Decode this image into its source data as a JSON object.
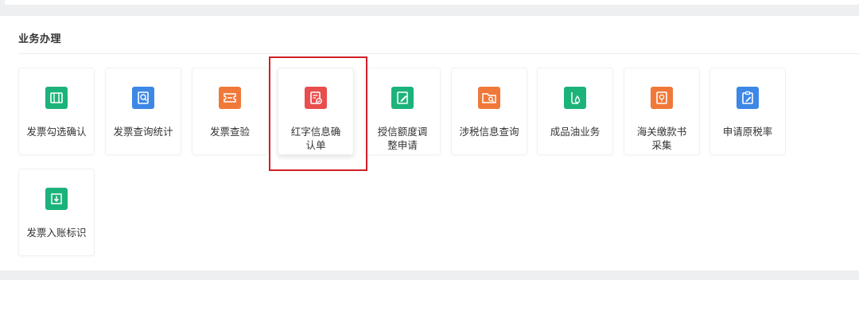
{
  "section": {
    "title": "业务办理"
  },
  "tiles": [
    {
      "label": "发票勾选确认",
      "icon": "ticket-icon",
      "color": "#1cb37a"
    },
    {
      "label": "发票查询统计",
      "icon": "document-search-icon",
      "color": "#3d87e6"
    },
    {
      "label": "发票查验",
      "icon": "ticket-check-icon",
      "color": "#f0793a"
    },
    {
      "label": "红字信息确认单",
      "icon": "document-check-icon",
      "color": "#e84e4e"
    },
    {
      "label": "授信额度调整申请",
      "icon": "document-edit-icon",
      "color": "#1cb37a"
    },
    {
      "label": "涉税信息查询",
      "icon": "folder-search-icon",
      "color": "#f0793a"
    },
    {
      "label": "成品油业务",
      "icon": "oil-drop-icon",
      "color": "#1cb37a"
    },
    {
      "label": "海关缴款书采集",
      "icon": "customs-receipt-icon",
      "color": "#f0793a"
    },
    {
      "label": "申请原税率",
      "icon": "clipboard-edit-icon",
      "color": "#3d87e6"
    },
    {
      "label": "发票入账标识",
      "icon": "download-box-icon",
      "color": "#1cb37a"
    }
  ]
}
